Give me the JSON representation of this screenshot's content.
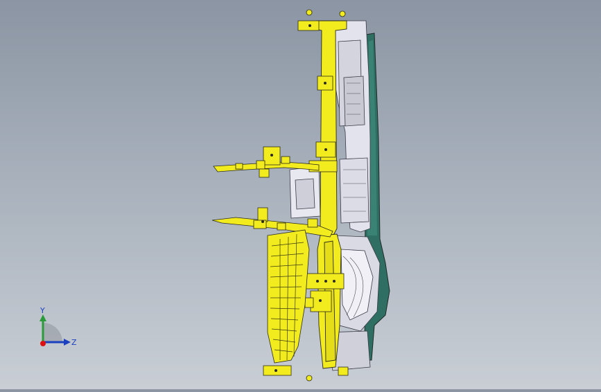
{
  "triad": {
    "y_label": "Y",
    "z_label": "Z"
  },
  "colors": {
    "background_top": "#8b95a3",
    "background_bottom": "#c9ced5",
    "part_yellow": "#f2ec1f",
    "part_outline": "#2a2a1a",
    "fan_teal": "#2f6e63",
    "frame_light": "#e6e6ef"
  },
  "icons": [
    "coordinate-triad-icon"
  ]
}
